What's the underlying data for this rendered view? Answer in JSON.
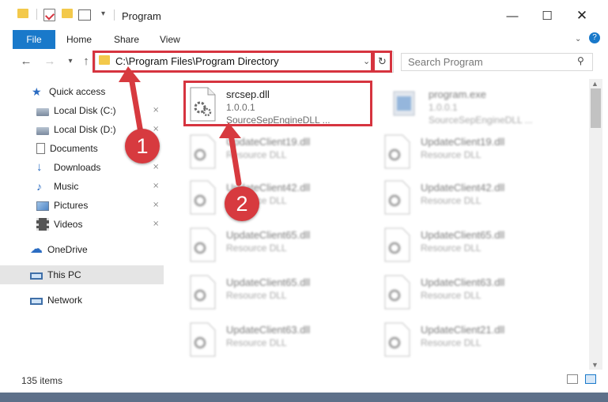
{
  "window": {
    "title": "Program",
    "ribbon": {
      "tabs": [
        "File",
        "Home",
        "Share",
        "View"
      ]
    },
    "address": "C:\\Program Files\\Program Directory",
    "search_placeholder": "Search Program",
    "sidebar": [
      {
        "label": "Quick access",
        "icon": "star-icon",
        "pinned": false
      },
      {
        "label": "Local Disk (C:)",
        "icon": "drive-icon",
        "pinned": true
      },
      {
        "label": "Local Disk (D:)",
        "icon": "drive-icon",
        "pinned": true
      },
      {
        "label": "Documents",
        "icon": "document-icon",
        "pinned": true
      },
      {
        "label": "Downloads",
        "icon": "download-icon",
        "pinned": true
      },
      {
        "label": "Music",
        "icon": "music-icon",
        "pinned": true
      },
      {
        "label": "Pictures",
        "icon": "picture-icon",
        "pinned": true
      },
      {
        "label": "Videos",
        "icon": "video-icon",
        "pinned": true
      },
      {
        "label": "OneDrive",
        "icon": "cloud-icon",
        "pinned": false
      },
      {
        "label": "This PC",
        "icon": "computer-icon",
        "pinned": false,
        "selected": true
      },
      {
        "label": "Network",
        "icon": "network-icon",
        "pinned": false
      }
    ],
    "files": [
      {
        "name": "srcsep.dll",
        "version": "1.0.0.1",
        "desc": "SourceSepEngineDLL ...",
        "highlighted": true
      },
      {
        "name": "program.exe",
        "version": "1.0.0.1",
        "desc": "SourceSepEngineDLL ..."
      },
      {
        "name": "UpdateClient19.dll",
        "desc": "Resource DLL"
      },
      {
        "name": "UpdateClient19.dll",
        "desc": "Resource DLL"
      },
      {
        "name": "UpdateClient42.dll",
        "desc": "Resource DLL"
      },
      {
        "name": "UpdateClient42.dll",
        "desc": "Resource DLL"
      },
      {
        "name": "UpdateClient65.dll",
        "desc": "Resource DLL"
      },
      {
        "name": "UpdateClient65.dll",
        "desc": "Resource DLL"
      },
      {
        "name": "UpdateClient65.dll",
        "desc": "Resource DLL"
      },
      {
        "name": "UpdateClient63.dll",
        "desc": "Resource DLL"
      },
      {
        "name": "UpdateClient63.dll",
        "desc": "Resource DLL"
      },
      {
        "name": "UpdateClient21.dll",
        "desc": "Resource DLL"
      }
    ],
    "status": "135 items",
    "badges": [
      "1",
      "2"
    ]
  },
  "colors": {
    "accent": "#1979ca",
    "highlight": "#d6343f"
  }
}
